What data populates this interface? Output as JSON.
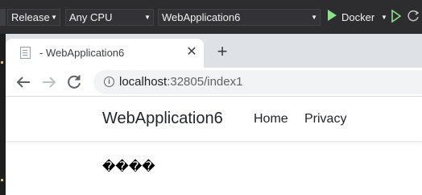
{
  "toolbar": {
    "configuration": "Release",
    "platform": "Any CPU",
    "startup_project": "WebApplication6",
    "run_target": "Docker",
    "play_icon": "play-icon",
    "play_without_debug_icon": "play-outline-icon"
  },
  "browser": {
    "tab": {
      "title": "- WebApplication6",
      "favicon": "page-icon",
      "close_icon": "close-icon"
    },
    "new_tab_icon": "plus-icon",
    "nav": {
      "back_icon": "back-arrow-icon",
      "forward_icon": "forward-arrow-icon",
      "reload_icon": "reload-icon",
      "info_icon": "info-icon"
    },
    "address": {
      "host": "localhost",
      "rest": ":32805/index1"
    }
  },
  "page": {
    "brand": "WebApplication6",
    "nav_links": [
      "Home",
      "Privacy"
    ],
    "body_text": "����"
  }
}
